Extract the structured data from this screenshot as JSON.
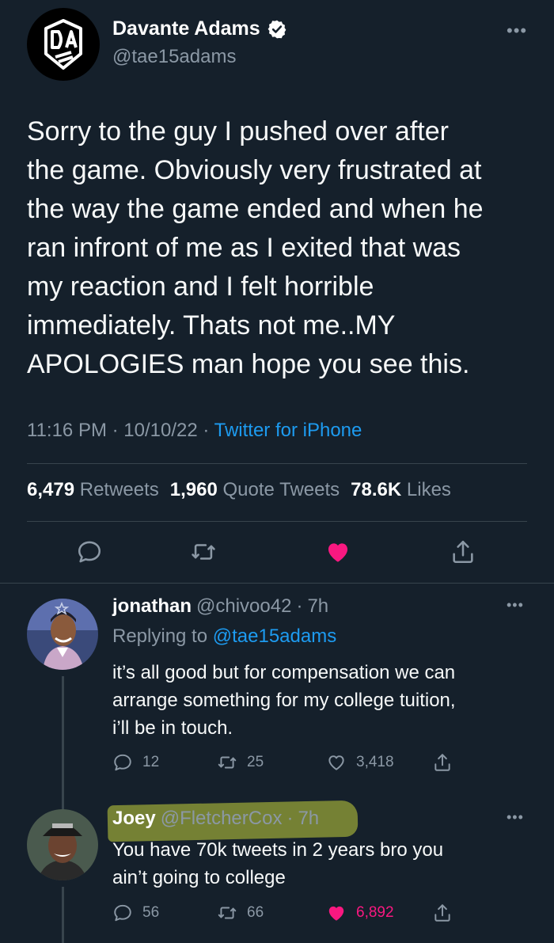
{
  "main_tweet": {
    "author": {
      "name": "Davante Adams",
      "handle": "@tae15adams",
      "verified": true,
      "avatar_icon": "da-logo-icon"
    },
    "text": "Sorry to the guy I pushed over after\nthe game. Obviously very frustrated at\nthe way the game ended and when he\nran infront of me as I exited that was\nmy reaction and I felt horrible\nimmediately. Thats not me..MY\nAPOLOGIES man hope you see this.",
    "time": "11:16 PM",
    "date": "10/10/22",
    "source": "Twitter for iPhone",
    "separator": "·",
    "stats": {
      "retweets": "6,479",
      "retweets_label": "Retweets",
      "quotes": "1,960",
      "quotes_label": "Quote Tweets",
      "likes": "78.6K",
      "likes_label": "Likes"
    },
    "liked": true
  },
  "replies": [
    {
      "name": "jonathan",
      "handle": "@chivoo42",
      "age": "7h",
      "replying_prefix": "Replying to",
      "replying_to": "@tae15adams",
      "text": "it’s all good but for compensation we can\narrange something for my college tuition,\ni’ll be in touch.",
      "counts": {
        "replies": "12",
        "retweets": "25",
        "likes": "3,418"
      },
      "liked": false
    },
    {
      "name": "Joey",
      "handle": "@FletcherCox",
      "age": "7h",
      "text": "You have 70k tweets in 2 years bro you\nain’t going to college",
      "counts": {
        "replies": "56",
        "retweets": "66",
        "likes": "6,892"
      },
      "liked": true,
      "highlighted": true
    }
  ],
  "colors": {
    "background": "#15202b",
    "accent": "#1d9bf0",
    "like": "#f91880",
    "muted": "#8b98a5",
    "highlight": "#c4d23c"
  }
}
